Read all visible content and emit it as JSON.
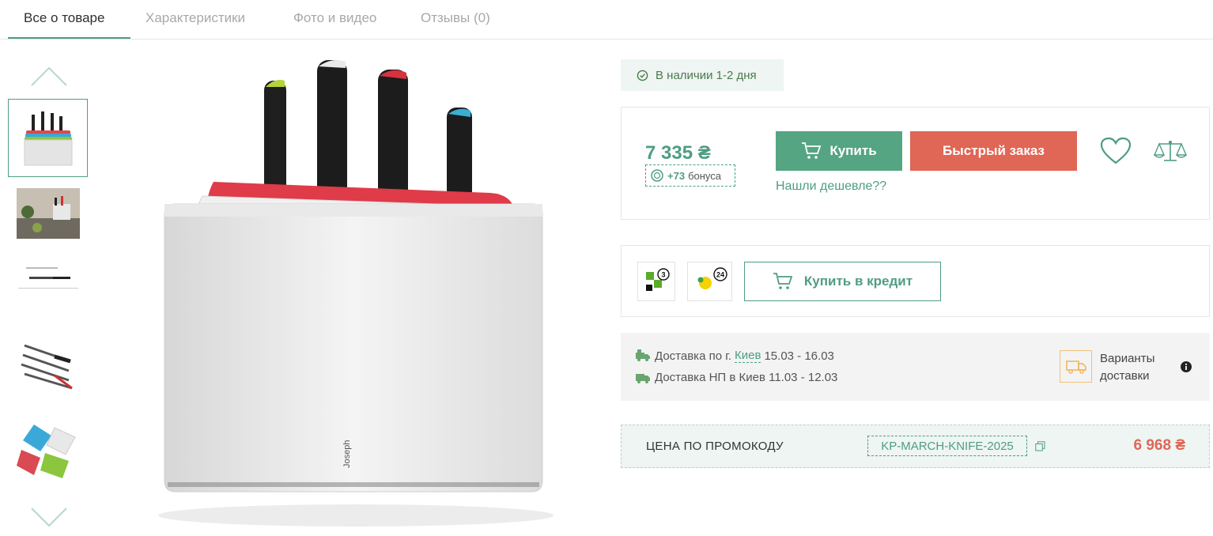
{
  "tabs": [
    {
      "label": "Все о товаре",
      "active": true
    },
    {
      "label": "Характеристики",
      "active": false
    },
    {
      "label": "Фото и видео",
      "active": false
    },
    {
      "label": "Отзывы (0)",
      "active": false
    }
  ],
  "gallery": {
    "thumbnails": [
      "thumb-knife-block",
      "thumb-kitchen",
      "thumb-knife-dimensions",
      "thumb-knives-set",
      "thumb-cutting-boards"
    ],
    "main_image_brand": [
      "Joseph",
      "Joseph"
    ]
  },
  "stock": {
    "text": "В наличии 1-2 дня",
    "icon": "check-circle-icon"
  },
  "price": {
    "value": "7 335 ₴",
    "bonus_amount": "+73",
    "bonus_label": "бонуса",
    "buy_label": "Купить",
    "quick_order_label": "Быстрый заказ",
    "cheaper_link": "Нашли дешевле??"
  },
  "credit": {
    "banks": [
      {
        "name": "privat-parts-logo",
        "badge": "3"
      },
      {
        "name": "mono-parts-logo",
        "badge": "24"
      }
    ],
    "button_label": "Купить в кредит"
  },
  "delivery": {
    "city_line_prefix": "Доставка по г.",
    "city": "Киев",
    "city_dates": "15.03 - 16.03",
    "np_line": "Доставка НП в Киев 11.03 - 12.03",
    "variants_line1": "Варианты",
    "variants_line2": "доставки"
  },
  "promo": {
    "label": "ЦЕНА ПО ПРОМОКОДУ",
    "code": "KP-MARCH-KNIFE-2025",
    "price": "6 968 ₴"
  },
  "colors": {
    "accent": "#4f9d83",
    "buy": "#55a582",
    "quick": "#e06655"
  }
}
